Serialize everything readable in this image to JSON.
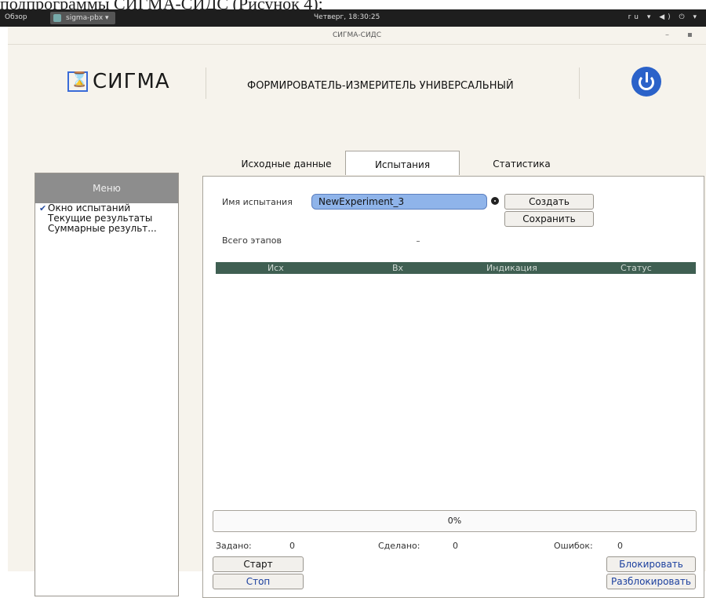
{
  "doc_caption_fragment": "подпрограммы СИГМА-СИДС (Рисунок 4);",
  "topbar": {
    "overview": "Обзор",
    "app_name": "sigma-pbx ▾",
    "clock": "Четверг, 18:30:25",
    "right_status": "ru ▾  ◀) ⏻ ▾"
  },
  "window": {
    "title": "СИГМА-СИДС",
    "min": "–",
    "close": "▪"
  },
  "header": {
    "logo_text": "СИГМА",
    "device_title": "ФОРМИРОВАТЕЛЬ-ИЗМЕРИТЕЛЬ УНИВЕРСАЛЬНЫЙ"
  },
  "sidebar": {
    "header": "Меню",
    "items": [
      {
        "label": "Окно испытаний",
        "checked": true
      },
      {
        "label": "Текущие результаты",
        "checked": false
      },
      {
        "label": "Суммарные результ...",
        "checked": false
      }
    ]
  },
  "tabs": [
    {
      "label": "Исходные данные",
      "active": false
    },
    {
      "label": "Испытания",
      "active": true
    },
    {
      "label": "Статистика",
      "active": false
    }
  ],
  "test": {
    "name_label": "Имя испытания",
    "name_value": "NewExperiment_3",
    "create_button": "Создать",
    "save_button": "Сохранить",
    "total_stages_label": "Всего этапов"
  },
  "table": {
    "columns": [
      "Исх",
      "Вх",
      "Индикация",
      "Статус"
    ],
    "rows": []
  },
  "progress": {
    "percent": 0,
    "text": "0%"
  },
  "stats": {
    "assigned_label": "Задано:",
    "assigned": "0",
    "done_label": "Сделано:",
    "done": "0",
    "errors_label": "Ошибок:",
    "errors": "0"
  },
  "controls": {
    "start": "Старт",
    "stop": "Стоп",
    "lock": "Блокировать",
    "unlock": "Разблокировать"
  },
  "colors": {
    "accent": "#2b62c9",
    "table_header": "#3f5f52",
    "input_bg": "#8fb4ea",
    "menu_header": "#8d8d8d"
  }
}
